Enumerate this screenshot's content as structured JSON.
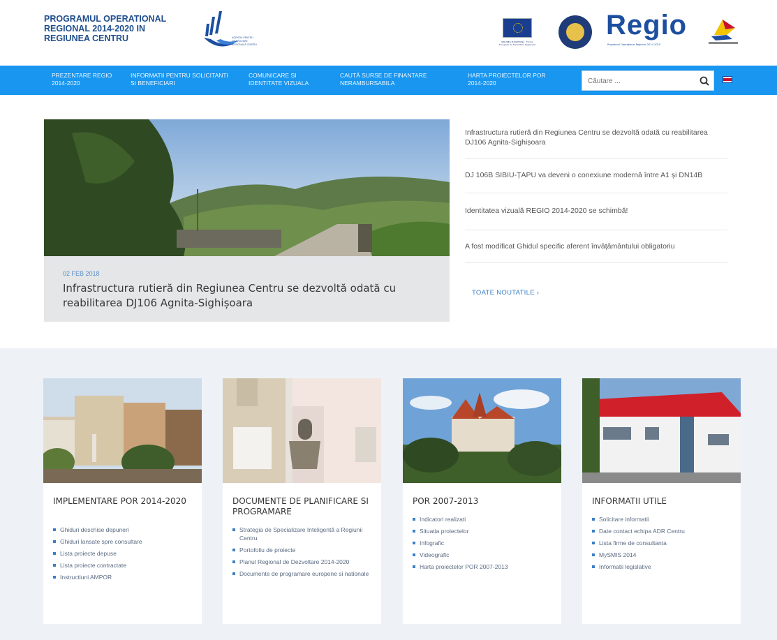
{
  "header": {
    "program_title": "PROGRAMUL OPERATIONAL REGIONAL 2014-2020 IN REGIUNEA CENTRU",
    "adr_logo_text": "AGENȚIA PENTRU DEZVOLTARE REGIONALĂ CENTRU",
    "eu_caption": "UNIUNEA EUROPEANĂ · Fondul European de Dezvoltare Regională",
    "regio_logo": "Regio",
    "regio_tagline": "Programul Operațional Regional 2014-2020"
  },
  "nav": {
    "items": [
      {
        "label": "PREZENTARE REGIO 2014-2020"
      },
      {
        "label": "INFORMATII PENTRU SOLICITANTI SI BENEFICIARI"
      },
      {
        "label": "COMUNICARE SI IDENTITATE VIZUALA"
      },
      {
        "label": "CAUTĂ SURSE DE FINANTARE NERAMBURSABILA"
      },
      {
        "label": "HARTA PROIECTELOR POR 2014-2020"
      }
    ],
    "search_placeholder": "Căutare ...",
    "accent_color": "#1896f0"
  },
  "featured": {
    "date": "02 FEB 2018",
    "title": "Infrastructura rutieră din Regiunea Centru se dezvoltă odată cu reabilitarea DJ106 Agnita-Sighișoara"
  },
  "news": {
    "items": [
      {
        "title": "Infrastructura rutieră din Regiunea Centru se dezvoltă odată cu reabilitarea DJ106 Agnita-Sighișoara"
      },
      {
        "title": "DJ 106B SIBIU-ȚAPU va deveni o conexiune modernă între A1 și DN14B"
      },
      {
        "title": "Identitatea vizuală REGIO 2014-2020 se schimbă!"
      },
      {
        "title": "A fost modificat Ghidul specific aferent învățământului obligatoriu"
      }
    ],
    "all_news": "TOATE NOUTATILE ›"
  },
  "cards": [
    {
      "title": "IMPLEMENTARE POR 2014-2020",
      "links": [
        "Ghiduri deschise depuneri",
        "Ghiduri lansate spre consultare",
        "Lista proiecte depuse",
        "Lista proiecte contractate",
        "Instructiuni AMPOR"
      ]
    },
    {
      "title": "DOCUMENTE DE PLANIFICARE SI PROGRAMARE",
      "links": [
        "Strategia de Specializare Inteligentă a Regiunii Centru",
        "Portofoliu de proiecte",
        "Planul Regional de Dezvoltare 2014-2020",
        "Documente de programare europene si nationale"
      ]
    },
    {
      "title": "POR 2007-2013",
      "links": [
        "Indicatori realizati",
        "Situatia proiectelor",
        "Infografic",
        "Videografic",
        "Harta proiectelor POR 2007-2013"
      ]
    },
    {
      "title": "INFORMATII UTILE",
      "links": [
        "Solicitare informatii",
        "Date contact echipa ADR Centru",
        "Lista firme de consultanta",
        "MySMIS 2014",
        "Informatii legislative"
      ]
    }
  ]
}
